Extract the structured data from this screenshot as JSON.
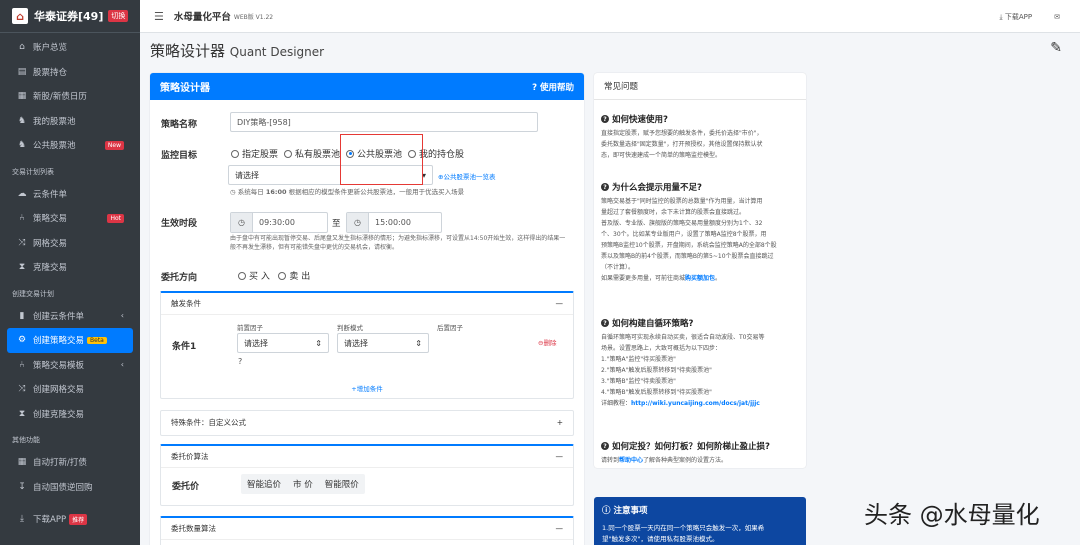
{
  "brand": {
    "name": "华泰证券[49]",
    "badge": "切换"
  },
  "nav": {
    "items_top": [
      {
        "icon": "⌂",
        "label": "账户总览"
      },
      {
        "icon": "▤",
        "label": "股票持仓"
      },
      {
        "icon": "▦",
        "label": "新股/新债日历"
      },
      {
        "icon": "♞",
        "label": "我的股票池"
      },
      {
        "icon": "♞",
        "label": "公共股票池",
        "badge": "New"
      }
    ],
    "section1": "交易计划列表",
    "items_mid": [
      {
        "icon": "☁",
        "label": "云条件单"
      },
      {
        "icon": "⑃",
        "label": "策略交易",
        "badge": "Hot"
      },
      {
        "icon": "⤨",
        "label": "网格交易"
      },
      {
        "icon": "⧗",
        "label": "克隆交易"
      }
    ],
    "section2": "创建交易计划",
    "items_create": [
      {
        "icon": "▮",
        "label": "创建云条件单",
        "arrow": "‹"
      },
      {
        "icon": "⚙",
        "label": "创建策略交易",
        "badge": "Beta",
        "active": true
      },
      {
        "icon": "⑃",
        "label": "策略交易模板",
        "arrow": "‹"
      },
      {
        "icon": "⤨",
        "label": "创建网格交易"
      },
      {
        "icon": "⧗",
        "label": "创建克隆交易"
      }
    ],
    "section3": "其他功能",
    "items_other": [
      {
        "icon": "▦",
        "label": "自动打新/打债"
      },
      {
        "icon": "↧",
        "label": "自动国债逆回购"
      }
    ],
    "download": {
      "label": "下载APP",
      "badge": "推荐"
    }
  },
  "topbar": {
    "title": "水母量化平台",
    "version": "WEB版 V1.22",
    "download": "下载APP"
  },
  "page": {
    "title": "策略设计器",
    "title_en": "Quant Designer"
  },
  "designer": {
    "header": "策略设计器",
    "help": "使用帮助",
    "name_label": "策略名称",
    "name_value": "DIY策略-[958]",
    "target_label": "监控目标",
    "targets": [
      {
        "label": "指定股票",
        "checked": false
      },
      {
        "label": "私有股票池",
        "checked": false
      },
      {
        "label": "公共股票池",
        "checked": true
      },
      {
        "label": "我的持仓股",
        "checked": false
      }
    ],
    "pool_select": "请选择",
    "pool_link": "公共股票池一览表",
    "pool_note_pre": "系统每日",
    "pool_note_time": "16:00",
    "pool_note_post": "根据相应的模型条件更新公共股票池，一般用于优选买入场景",
    "time_label": "生效时段",
    "time_start": "09:30:00",
    "time_sep": "至",
    "time_end": "15:00:00",
    "time_note": "由于盘中有可能出现暂停交易、后尾盘又发生指标漂移的情形；为避免指标漂移，可设置从14:50开始生效，这样得出的结果一般不再发生漂移，但有可能错失盘中更优的交易机会，请权衡。",
    "direction_label": "委托方向",
    "directions": [
      "买 入",
      "卖 出"
    ],
    "trigger": {
      "title": "触发条件",
      "collapse": "—",
      "front_label": "前置因子",
      "judge_label": "判断模式",
      "back_label": "后置因子",
      "cond_label": "条件1",
      "front_select": "请选择",
      "judge_select": "请选择",
      "delete": "删除",
      "add": "增加条件"
    },
    "special": {
      "title": "特殊条件：自定义公式",
      "expand": "+"
    },
    "price": {
      "title": "委托价算法",
      "collapse": "—",
      "label": "委托价",
      "options": [
        "智能追价",
        "市 价",
        "智能限价"
      ]
    },
    "qty": {
      "title": "委托数量算法",
      "collapse": "—"
    }
  },
  "faq": {
    "header": "常见问题",
    "q1": "如何快速使用?",
    "a1": [
      "直接指定股票，赋予您想要的触发条件，委托价选择\"市价\"，",
      "委托数量选择\"固定数量\"，打开预授权，其他设置保持默认状",
      "态，即可快速建成一个简单的策略监控模型。"
    ],
    "q2": "为什么会提示用量不足?",
    "a2": [
      "策略交易基于\"同时监控的股票的总数量\"作为用量，当计算用",
      "量超过了套餐额度时，余下未计算的股票会直接跳过。",
      "普及版、专业版、旗舰版的策略交易用量额度分别为1个、32",
      "个、30个。比如某专业版用户，设置了策略A监控8个股票，用",
      "预策略B监控10个股票，开盘期间，系统会监控策略A的全部8个股",
      "票以及策略B的前4个股票，而策略B的第5~10个股票会直接跳过",
      "（不计算）。"
    ],
    "a2_more": "如果需要更多用量，可前往商城",
    "a2_link": "购买额加包",
    "a2_end": "。",
    "q3": "如何构建自循环策略?",
    "a3": [
      "自循环策略可实现永续自动买卖，很适合自动波段、T0交易等",
      "场景。设置思路上，大致可概括为以下四步：",
      "1.\"策略A\"监控\"待买股票池\"",
      "2.\"策略A\"触发后股票转移到\"待卖股票池\"",
      "3.\"策略B\"监控\"待卖股票池\"",
      "4.\"策略B\"触发后股票转移到\"待买股票池\""
    ],
    "a3_tut": "详细教程：",
    "a3_url": "http://wiki.yuncaijing.com/docs/jat/jjjc",
    "q4": "如何定投？如何打板？如何阶梯止盈止损?",
    "a4_pre": "请转到",
    "a4_link": "帮助中心",
    "a4_post": "了解各种典型案例的设置方法。"
  },
  "notice": {
    "title": "注意事项",
    "line1": "1.同一个股票一天内在同一个策略只会触发一次，如果希",
    "line2": "望\"触发多次\"，请使用私有股票池模式。"
  },
  "watermark": "头条 @水母量化"
}
